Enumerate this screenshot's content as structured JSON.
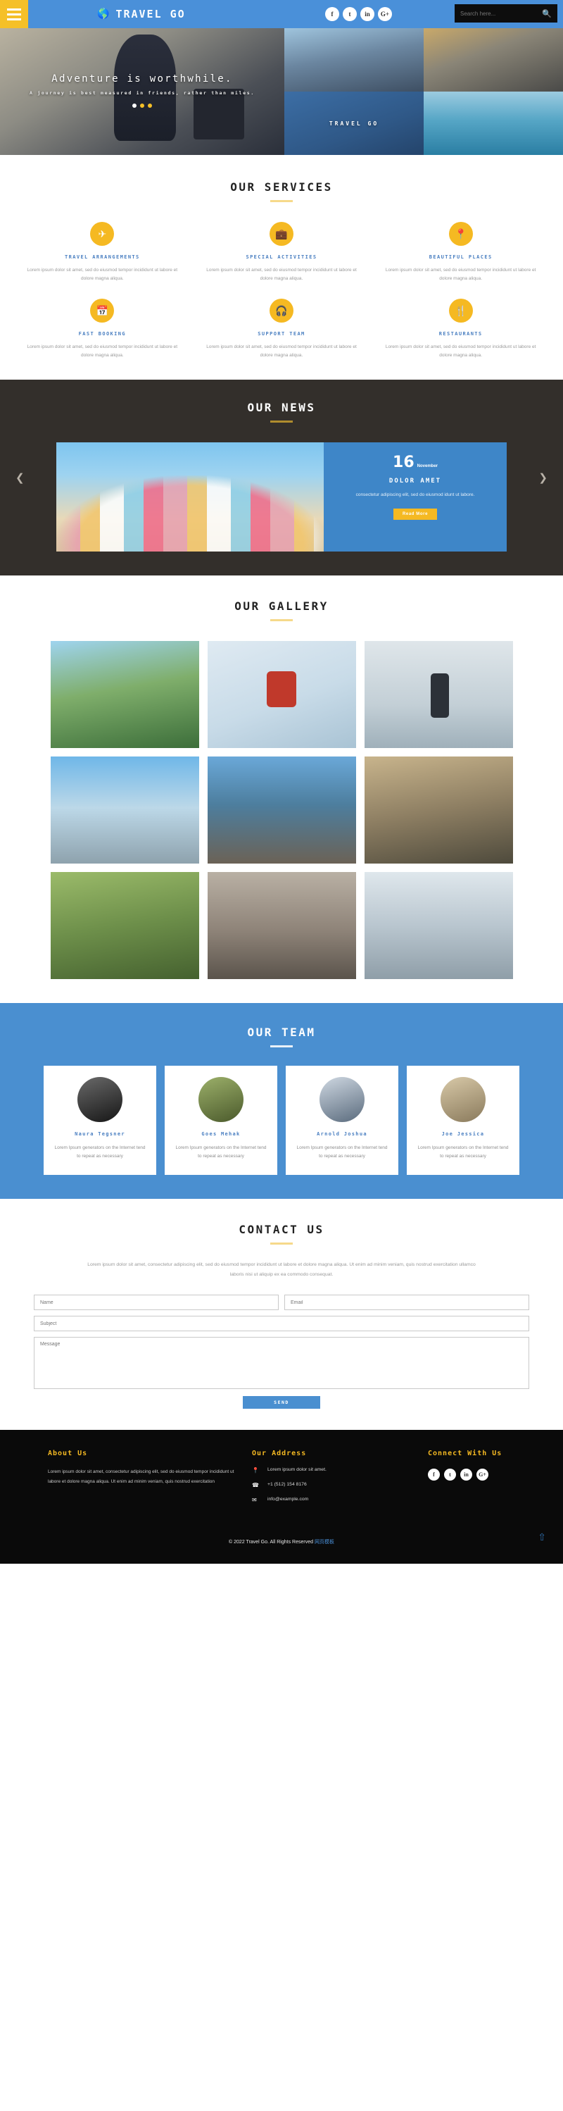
{
  "header": {
    "menu_icon": "hamburger-icon",
    "brand": "TRAVEL GO",
    "brand_icon": "globe-icon",
    "social": [
      {
        "name": "facebook-icon",
        "glyph": "f"
      },
      {
        "name": "twitter-icon",
        "glyph": "t"
      },
      {
        "name": "linkedin-icon",
        "glyph": "in"
      },
      {
        "name": "google-plus-icon",
        "glyph": "G+"
      }
    ],
    "search_placeholder": "Search here...",
    "search_value": "",
    "search_icon": "search-icon"
  },
  "hero": {
    "title": "Adventure is worthwhile.",
    "subtitle": "A journey is best measured in friends, rather than miles.",
    "dots": 3,
    "active_dot": 1,
    "tile_label": "TRAVEL GO"
  },
  "services": {
    "title": "OUR SERVICES",
    "items": [
      {
        "icon": "airplane-icon",
        "glyph": "✈",
        "name": "TRAVEL ARRANGEMENTS",
        "text": "Lorem ipsum dolor sit amet, sed do eiusmod tempor incididunt ut labore et dolore magna aliqua."
      },
      {
        "icon": "briefcase-icon",
        "glyph": "💼",
        "name": "SPECIAL ACTIVITIES",
        "text": "Lorem ipsum dolor sit amet, sed do eiusmod tempor incididunt ut labore et dolore magna aliqua."
      },
      {
        "icon": "map-pin-icon",
        "glyph": "📍",
        "name": "BEAUTIFUL PLACES",
        "text": "Lorem ipsum dolor sit amet, sed do eiusmod tempor incididunt ut labore et dolore magna aliqua."
      },
      {
        "icon": "calendar-icon",
        "glyph": "📅",
        "name": "FAST BOOKING",
        "text": "Lorem ipsum dolor sit amet, sed do eiusmod tempor incididunt ut labore et dolore magna aliqua."
      },
      {
        "icon": "headset-icon",
        "glyph": "🎧",
        "name": "SUPPORT TEAM",
        "text": "Lorem ipsum dolor sit amet, sed do eiusmod tempor incididunt ut labore et dolore magna aliqua."
      },
      {
        "icon": "cutlery-icon",
        "glyph": "🍴",
        "name": "RESTAURANTS",
        "text": "Lorem ipsum dolor sit amet, sed do eiusmod tempor incididunt ut labore et dolore magna aliqua."
      }
    ]
  },
  "news": {
    "title": "OUR NEWS",
    "prev_icon": "chevron-left-icon",
    "next_icon": "chevron-right-icon",
    "card": {
      "day": "16",
      "month": "November",
      "headline": "DOLOR AMET",
      "description": "consectetur adipiscing elit, sed do eiusmod idunt ut labore.",
      "button": "Read More"
    }
  },
  "gallery": {
    "title": "OUR GALLERY",
    "items": [
      "mountain-hiker-photo",
      "skier-photo",
      "traveler-coast-photo",
      "venice-bridge-photo",
      "harbor-dock-photo",
      "road-trip-photo",
      "woman-field-photo",
      "railway-backpacker-photo",
      "skydiver-photo"
    ]
  },
  "team": {
    "title": "OUR TEAM",
    "members": [
      {
        "name": "Naura Tegsner",
        "text": "Lorem Ipsum generators on the Internet tend to repeat as necessary"
      },
      {
        "name": "Goes Mehak",
        "text": "Lorem Ipsum generators on the Internet tend to repeat as necessary"
      },
      {
        "name": "Arnold Joshua",
        "text": "Lorem Ipsum generators on the Internet tend to repeat as necessary"
      },
      {
        "name": "Joe Jessica",
        "text": "Lorem Ipsum generators on the Internet tend to repeat as necessary"
      }
    ]
  },
  "contact": {
    "title": "CONTACT US",
    "intro": "Lorem ipsum dolor sit amet, consectetur adipiscing elit, sed do eiusmod tempor incididunt ut labore et dolore magna aliqua. Ut enim ad minim veniam, quis nostrud exercitation ullamco laboris nisi ut aliquip ex ea commodo consequat.",
    "name_placeholder": "Name",
    "email_placeholder": "Email",
    "subject_placeholder": "Subject",
    "message_placeholder": "Message",
    "name_value": "",
    "email_value": "",
    "subject_value": "",
    "message_value": "",
    "send_label": "SEND"
  },
  "footer": {
    "about_title": "About Us",
    "about_text": "Lorem ipsum dolor sit amet, consectetur adipiscing elit, sed do eiusmod tempor incididunt ut labore et dolore magna aliqua. Ut enim ad minim veniam, quis nostrud exercitation",
    "address_title": "Our Address",
    "address_line": "Lorem ipsum dolor sit amet.",
    "phone": "+1 (512) 154 8176",
    "email": "info@example.com",
    "location_icon": "map-pin-icon",
    "phone_icon": "phone-icon",
    "email_icon": "envelope-icon",
    "connect_title": "Connect With Us",
    "social": [
      {
        "name": "facebook-icon",
        "glyph": "f"
      },
      {
        "name": "twitter-icon",
        "glyph": "t"
      },
      {
        "name": "linkedin-icon",
        "glyph": "in"
      },
      {
        "name": "google-plus-icon",
        "glyph": "G+"
      }
    ],
    "copyright": "© 2022 Travel Go. All Rights Reserved",
    "copyright_link": "网页模板",
    "back_to_top_icon": "upload-icon"
  },
  "colors": {
    "brand_blue": "#4a90d9",
    "accent_yellow": "#f5b922",
    "dark": "#332f2b",
    "footer": "#0a0a0a"
  }
}
